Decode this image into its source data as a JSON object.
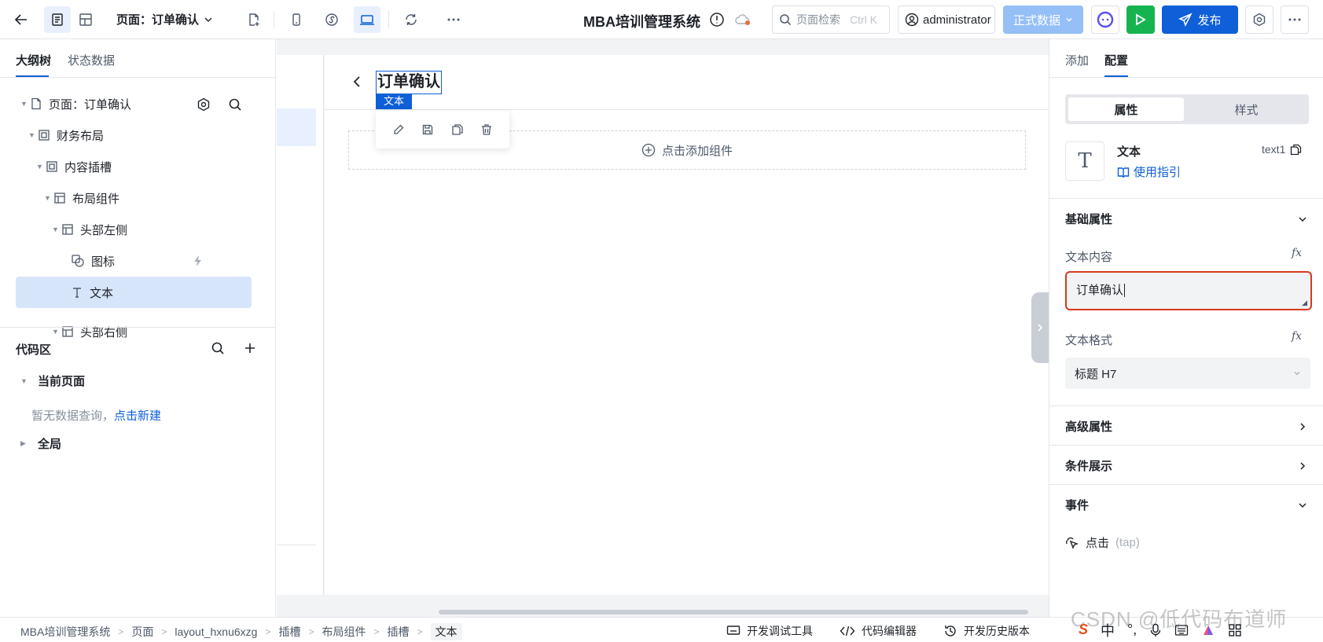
{
  "toolbar": {
    "page_select_label": "页面：订单确认",
    "app_title": "MBA培训管理系统",
    "search_label": "页面检索",
    "search_shortcut": "Ctrl K",
    "user_name": "administrator",
    "env_label": "正式数据",
    "publish_label": "发布",
    "colors": {
      "primary": "#0e5fd8",
      "run": "#16b450",
      "env": "#94bff7"
    }
  },
  "left_panel": {
    "tabs": [
      {
        "label": "大纲树"
      },
      {
        "label": "状态数据"
      }
    ],
    "tree": [
      {
        "label": "页面：订单确认"
      },
      {
        "label": "财务布局"
      },
      {
        "label": "内容插槽"
      },
      {
        "label": "布局组件"
      },
      {
        "label": "头部左侧"
      },
      {
        "label": "图标"
      },
      {
        "label": "文本"
      },
      {
        "label": "头部右侧"
      }
    ],
    "code_title": "代码区",
    "current_page_label": "当前页面",
    "empty_text": "暂无数据查询，",
    "create_link": "点击新建",
    "global_label": "全局"
  },
  "canvas": {
    "selected_text": "订单确认",
    "selected_tag": "文本",
    "add_component_label": "点击添加组件"
  },
  "right_panel": {
    "tabs": [
      {
        "label": "添加"
      },
      {
        "label": "配置"
      }
    ],
    "segment": {
      "active": "属性",
      "other": "样式"
    },
    "component": {
      "icon_glyph": "T",
      "name": "文本",
      "guide": "使用指引",
      "id": "text1"
    },
    "basic_section": "基础属性",
    "text_content_label": "文本内容",
    "text_content_value": "订单确认",
    "text_format_label": "文本格式",
    "text_format_value": "标题 H7",
    "advanced_section": "高级属性",
    "condition_section": "条件展示",
    "event_section": "事件",
    "event_name": "点击",
    "event_code": "(tap)",
    "fx_label": "fx"
  },
  "statusbar": {
    "breadcrumb": [
      "MBA培训管理系统",
      "页面",
      "layout_hxnu6xzg",
      "插槽",
      "布局组件",
      "插槽",
      "文本"
    ],
    "tools": [
      "开发调试工具",
      "代码编辑器",
      "开发历史版本"
    ]
  },
  "watermark": "CSDN @低代码布道师",
  "ime": {
    "lang": "中"
  }
}
